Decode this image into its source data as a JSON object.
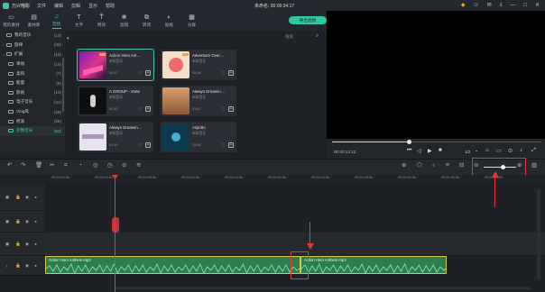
{
  "titlebar": {
    "app_name": "万兴喵影",
    "menus": [
      "文件",
      "编辑",
      "剪辑",
      "显示",
      "帮助"
    ],
    "project": "未命名: 00:00:34:17"
  },
  "toolbar": {
    "tabs": [
      {
        "label": "我的素材",
        "icon": "▭"
      },
      {
        "label": "素材库",
        "icon": "▤"
      },
      {
        "label": "音频",
        "icon": "♫"
      },
      {
        "label": "文字",
        "icon": "T"
      },
      {
        "label": "特效",
        "icon": "T̃"
      },
      {
        "label": "滤镜",
        "icon": "❀"
      },
      {
        "label": "转场",
        "icon": "⧉"
      },
      {
        "label": "贴纸",
        "icon": "◐"
      },
      {
        "label": "分屏",
        "icon": "▦"
      }
    ],
    "export_label": "导出视频"
  },
  "categories": [
    {
      "label": "我的音乐",
      "count": "(13)"
    },
    {
      "label": "旋律",
      "count": "(32)"
    },
    {
      "label": "扩展",
      "count": "(13)"
    },
    {
      "label": "幸福",
      "count": "(14)"
    },
    {
      "label": "柔和",
      "count": "(7)"
    },
    {
      "label": "能量",
      "count": "(6)"
    },
    {
      "label": "影视",
      "count": "(13)"
    },
    {
      "label": "电子音乐",
      "count": "(11)"
    },
    {
      "label": "Vlog风",
      "count": "(29)"
    },
    {
      "label": "摇滚",
      "count": "(25)"
    },
    {
      "label": "完整音乐",
      "count": "(83)"
    }
  ],
  "search_placeholder": "搜索",
  "cards": [
    {
      "title": "Action Hero Ant…",
      "sub": "未知音乐",
      "dur": "02:07"
    },
    {
      "title": "Adventure Over…",
      "sub": "未知音乐",
      "dur": "00:38"
    },
    {
      "title": "A GROUP - Vorte",
      "sub": "未知音乐",
      "dur": "02:33"
    },
    {
      "title": "Always Dreamin…",
      "sub": "未知音乐",
      "dur": "01:57"
    },
    {
      "title": "Always Dreamin…",
      "sub": "未知音乐",
      "dur": "01:19"
    },
    {
      "title": "Anjiritto",
      "sub": "未知音乐",
      "dur": "02:55"
    }
  ],
  "preview": {
    "timecode": "00:00:12:12",
    "ratio": "1/2"
  },
  "ruler_labels": [
    "00:00:00:00",
    "00:00:04:00",
    "00:00:08:00",
    "00:00:12:00",
    "00:00:16:00",
    "00:00:20:00",
    "00:00:24:00",
    "00:00:28:00",
    "00:00:32:00",
    "00:00:36:00",
    "00:00:40:00"
  ],
  "clips": {
    "clip1": "Action Hero Anthem.mp3",
    "clip2": "Action Hero Anthem.mp3"
  },
  "colors": {
    "accent": "#3ec7a6",
    "highlight": "#e5383b",
    "clip": "#2e7d4f"
  }
}
